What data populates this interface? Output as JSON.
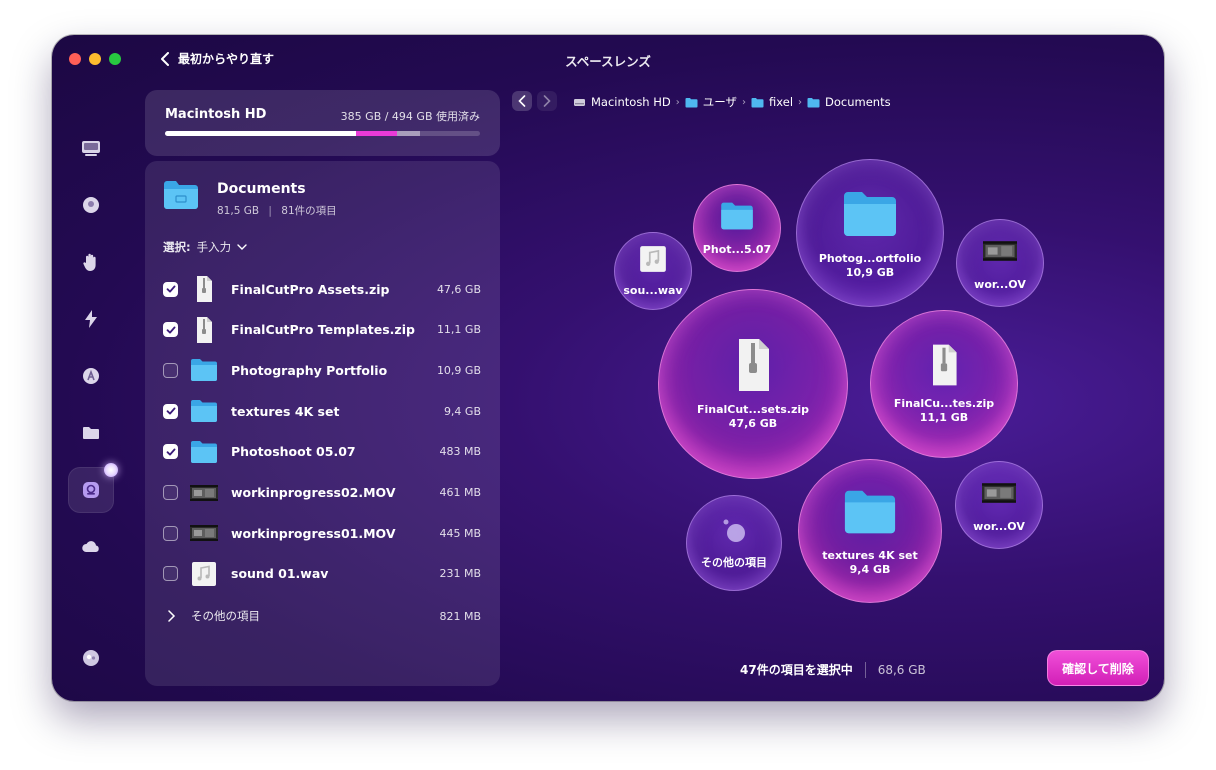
{
  "window": {
    "title": "スペースレンズ",
    "back_label": "最初からやり直す"
  },
  "disk": {
    "name": "Macintosh HD",
    "usage": "385 GB / 494 GB 使用済み",
    "used_fraction": 0.605,
    "selected_fraction": 0.133,
    "other_fraction": 0.07
  },
  "folder": {
    "title": "Documents",
    "size": "81,5 GB",
    "count": "81件の項目",
    "select_label": "選択:",
    "select_mode": "手入力"
  },
  "items": [
    {
      "name": "FinalCutPro Assets.zip",
      "size": "47,6 GB",
      "checked": true,
      "icon": "zip-icon"
    },
    {
      "name": "FinalCutPro Templates.zip",
      "size": "11,1 GB",
      "checked": true,
      "icon": "zip-icon"
    },
    {
      "name": "Photography Portfolio",
      "size": "10,9 GB",
      "checked": false,
      "icon": "folder-icon"
    },
    {
      "name": "textures 4K set",
      "size": "9,4 GB",
      "checked": true,
      "icon": "folder-icon"
    },
    {
      "name": "Photoshoot 05.07",
      "size": "483 MB",
      "checked": true,
      "icon": "folder-icon"
    },
    {
      "name": "workinprogress02.MOV",
      "size": "461 MB",
      "checked": false,
      "icon": "video-icon"
    },
    {
      "name": "workinprogress01.MOV",
      "size": "445 MB",
      "checked": false,
      "icon": "video-icon"
    },
    {
      "name": "sound 01.wav",
      "size": "231 MB",
      "checked": false,
      "icon": "audio-icon"
    }
  ],
  "other_items": {
    "label": "その他の項目",
    "size": "821 MB"
  },
  "breadcrumbs": [
    "Macintosh HD",
    "ユーザ",
    "fixel",
    "Documents"
  ],
  "bubbles": [
    {
      "label": "FinalCut...sets.zip",
      "size": "47,6 GB"
    },
    {
      "label": "FinalCu...tes.zip",
      "size": "11,1 GB"
    },
    {
      "label": "Photog...ortfolio",
      "size": "10,9 GB"
    },
    {
      "label": "textures 4K set",
      "size": "9,4 GB"
    },
    {
      "label": "Phot...5.07",
      "size": ""
    },
    {
      "label": "sou...wav",
      "size": ""
    },
    {
      "label": "wor...OV",
      "size": ""
    },
    {
      "label": "wor...OV",
      "size": ""
    },
    {
      "label": "その他の項目",
      "size": ""
    }
  ],
  "footer": {
    "selected_text": "47件の項目を選択中",
    "selected_size": "68,6 GB",
    "delete_label": "確認して削除"
  },
  "colors": {
    "accent": "#e93ad8",
    "folder": "#4fb8f0",
    "background": "#2a0c5e"
  }
}
